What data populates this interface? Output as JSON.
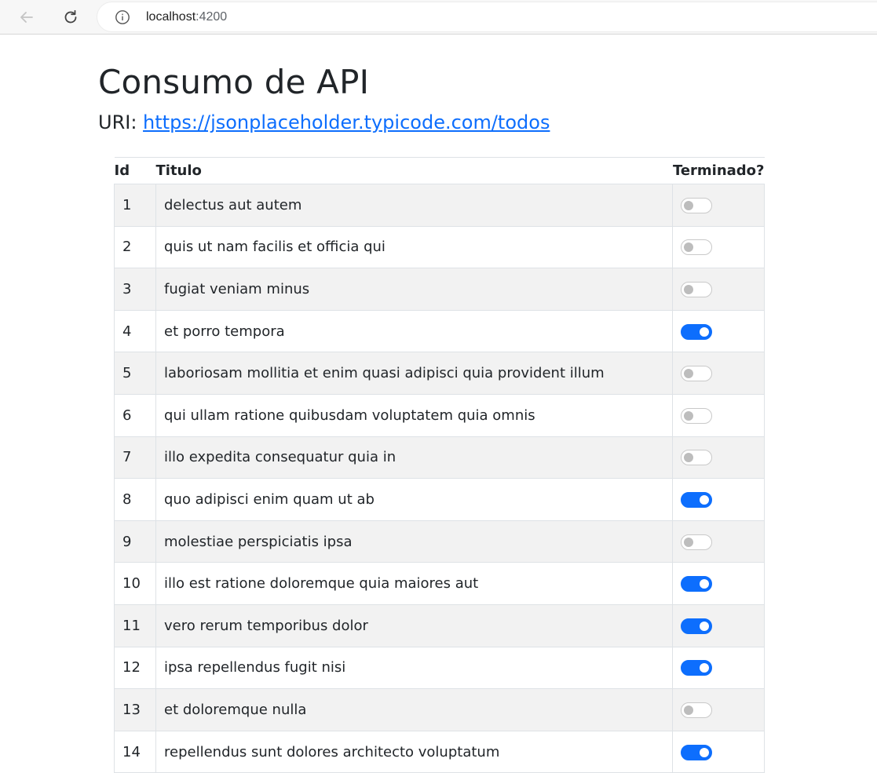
{
  "browser": {
    "url_host": "localhost",
    "url_port": ":4200"
  },
  "page": {
    "title": "Consumo de API",
    "uri_label": "URI:",
    "uri_link": "https://jsonplaceholder.typicode.com/todos"
  },
  "table": {
    "headers": {
      "id": "Id",
      "title": "Titulo",
      "done": "Terminado?"
    },
    "rows": [
      {
        "id": "1",
        "title": "delectus aut autem",
        "completed": false
      },
      {
        "id": "2",
        "title": "quis ut nam facilis et officia qui",
        "completed": false
      },
      {
        "id": "3",
        "title": "fugiat veniam minus",
        "completed": false
      },
      {
        "id": "4",
        "title": "et porro tempora",
        "completed": true
      },
      {
        "id": "5",
        "title": "laboriosam mollitia et enim quasi adipisci quia provident illum",
        "completed": false
      },
      {
        "id": "6",
        "title": "qui ullam ratione quibusdam voluptatem quia omnis",
        "completed": false
      },
      {
        "id": "7",
        "title": "illo expedita consequatur quia in",
        "completed": false
      },
      {
        "id": "8",
        "title": "quo adipisci enim quam ut ab",
        "completed": true
      },
      {
        "id": "9",
        "title": "molestiae perspiciatis ipsa",
        "completed": false
      },
      {
        "id": "10",
        "title": "illo est ratione doloremque quia maiores aut",
        "completed": true
      },
      {
        "id": "11",
        "title": "vero rerum temporibus dolor",
        "completed": true
      },
      {
        "id": "12",
        "title": "ipsa repellendus fugit nisi",
        "completed": true
      },
      {
        "id": "13",
        "title": "et doloremque nulla",
        "completed": false
      },
      {
        "id": "14",
        "title": "repellendus sunt dolores architecto voluptatum",
        "completed": true
      }
    ]
  },
  "colors": {
    "accent": "#0d6efd",
    "stripe": "#f2f2f2"
  }
}
